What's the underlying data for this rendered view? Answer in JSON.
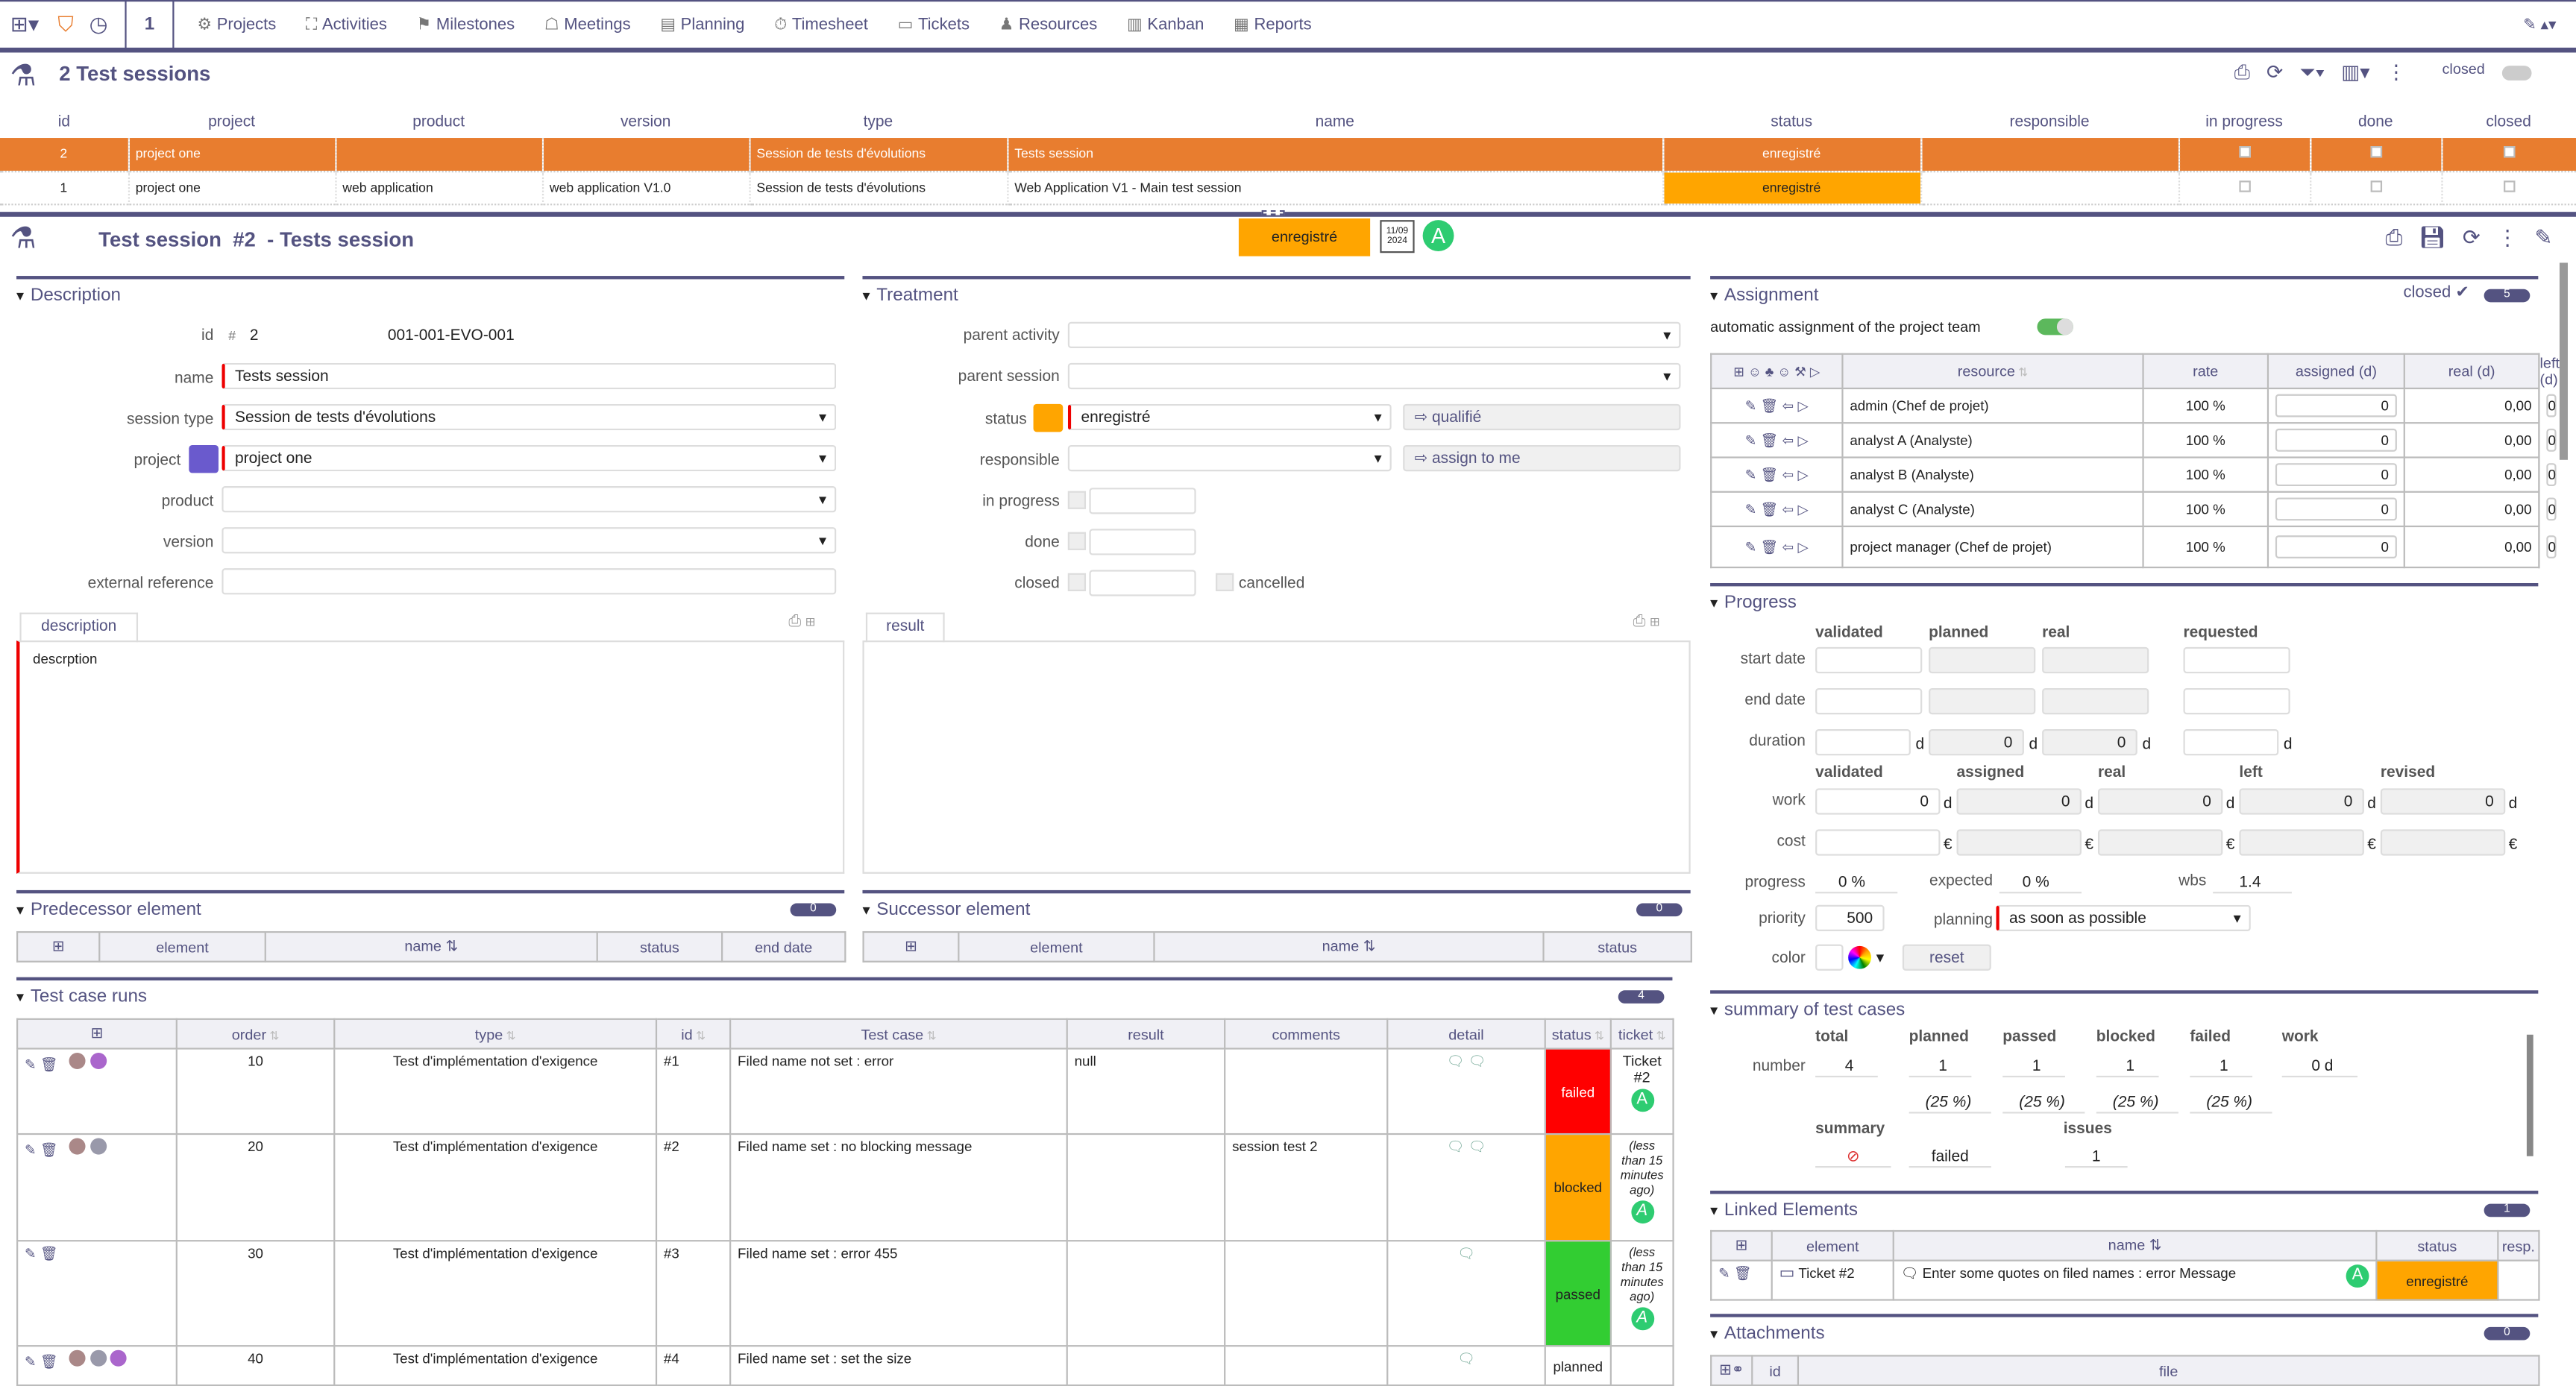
{
  "topbar": {
    "counter": "1",
    "menu": [
      {
        "label": "Projects",
        "icon": "gear-icon",
        "glyph": "⚙"
      },
      {
        "label": "Activities",
        "icon": "activities-icon",
        "glyph": "⛶"
      },
      {
        "label": "Milestones",
        "icon": "flag-icon",
        "glyph": "⚑"
      },
      {
        "label": "Meetings",
        "icon": "meeting-icon",
        "glyph": "☖"
      },
      {
        "label": "Planning",
        "icon": "planning-icon",
        "glyph": "▤"
      },
      {
        "label": "Timesheet",
        "icon": "stopwatch-icon",
        "glyph": "⏱"
      },
      {
        "label": "Tickets",
        "icon": "ticket-icon",
        "glyph": "▭"
      },
      {
        "label": "Resources",
        "icon": "person-icon",
        "glyph": "♟"
      },
      {
        "label": "Kanban",
        "icon": "kanban-icon",
        "glyph": "▥"
      },
      {
        "label": "Reports",
        "icon": "chart-icon",
        "glyph": "▦"
      }
    ]
  },
  "list": {
    "title": "2 Test sessions",
    "closed_label": "closed",
    "columns": [
      "id",
      "project",
      "product",
      "version",
      "type",
      "name",
      "status",
      "responsible",
      "in progress",
      "done",
      "closed"
    ],
    "rows": [
      {
        "id": "2",
        "project": "project one",
        "product": "",
        "version": "",
        "type": "Session de tests d'évolutions",
        "name": "Tests session",
        "status": "enregistré",
        "responsible": "",
        "selected": true
      },
      {
        "id": "1",
        "project": "project one",
        "product": "web application",
        "version": "web application V1.0",
        "type": "Session de tests d'évolutions",
        "name": "Web Application V1 - Main test session",
        "status": "enregistré",
        "responsible": "",
        "selected": false
      }
    ]
  },
  "detail": {
    "title": "Test session  #2  - Tests session",
    "status": "enregistré",
    "date_icon_text": "11/09\n2024",
    "avatar": "A",
    "description": {
      "title": "Description",
      "id_label": "id",
      "id_hash": "#",
      "id": "2",
      "ref": "001-001-EVO-001",
      "name_label": "name",
      "name": "Tests session",
      "session_type_label": "session type",
      "session_type": "Session de tests d'évolutions",
      "project_label": "project",
      "project": "project one",
      "project_color": "#6A5ACD",
      "product_label": "product",
      "product": "",
      "version_label": "version",
      "version": "",
      "external_reference_label": "external reference",
      "external_reference": "",
      "tab": "description",
      "text": "descrption"
    },
    "treatment": {
      "title": "Treatment",
      "parent_activity_label": "parent activity",
      "parent_session_label": "parent session",
      "status_label": "status",
      "status": "enregistré",
      "status_color": "#FFA500",
      "qualify_button": "qualifié",
      "responsible_label": "responsible",
      "assign_button": "assign to me",
      "in_progress_label": "in progress",
      "done_label": "done",
      "closed_label": "closed",
      "cancelled_label": "cancelled",
      "tab": "result"
    },
    "predecessor": {
      "title": "Predecessor element",
      "count": "0",
      "columns": [
        "element",
        "name",
        "status",
        "end date"
      ]
    },
    "successor": {
      "title": "Successor element",
      "count": "0",
      "columns": [
        "element",
        "name",
        "status"
      ]
    },
    "test_case_runs": {
      "title": "Test case runs",
      "count": "4",
      "columns": [
        "order",
        "type",
        "id",
        "Test case",
        "result",
        "comments",
        "detail",
        "status",
        "ticket"
      ],
      "rows": [
        {
          "order": "10",
          "type": "Test d'implémentation d'exigence",
          "id": "#1",
          "test_case": "Filed name not set : error",
          "result": "null",
          "comments": "",
          "status": "failed",
          "status_color": "#FF0000",
          "ticket": "Ticket #2"
        },
        {
          "order": "20",
          "type": "Test d'implémentation d'exigence",
          "id": "#2",
          "test_case": "Filed name set : no blocking message",
          "result": "",
          "comments": "session test 2",
          "status": "blocked",
          "status_color": "#FFA500",
          "ticket": "(less than 15 minutes ago)"
        },
        {
          "order": "30",
          "type": "Test d'implémentation d'exigence",
          "id": "#3",
          "test_case": "Filed name set : error 455",
          "result": "",
          "comments": "",
          "status": "passed",
          "status_color": "#32CD32",
          "ticket": "(less than 15 minutes ago)"
        },
        {
          "order": "40",
          "type": "Test d'implémentation d'exigence",
          "id": "#4",
          "test_case": "Filed name set : set the size",
          "result": "",
          "comments": "",
          "status": "planned",
          "status_color": "",
          "ticket": ""
        }
      ]
    },
    "assignment": {
      "title": "Assignment",
      "closed_label": "closed",
      "count": "5",
      "auto_label": "automatic assignment of the project team",
      "auto_on": true,
      "columns": [
        "resource",
        "rate",
        "assigned (d)",
        "real (d)",
        "left (d)"
      ],
      "rows": [
        {
          "resource": "admin (Chef de projet)",
          "rate": "100 %",
          "assigned": "0",
          "real": "0,00",
          "left": "0"
        },
        {
          "resource": "analyst A (Analyste)",
          "rate": "100 %",
          "assigned": "0",
          "real": "0,00",
          "left": "0"
        },
        {
          "resource": "analyst B (Analyste)",
          "rate": "100 %",
          "assigned": "0",
          "real": "0,00",
          "left": "0"
        },
        {
          "resource": "analyst C (Analyste)",
          "rate": "100 %",
          "assigned": "0",
          "real": "0,00",
          "left": "0"
        },
        {
          "resource": "project manager (Chef de projet)",
          "rate": "100 %",
          "assigned": "0",
          "real": "0,00",
          "left": "0"
        }
      ]
    },
    "progress": {
      "title": "Progress",
      "date_cols": [
        "validated",
        "planned",
        "real",
        "requested"
      ],
      "start_label": "start date",
      "end_label": "end date",
      "duration_label": "duration",
      "duration": [
        "",
        "0",
        "0",
        ""
      ],
      "unit_d": "d",
      "unit_eur": "€",
      "work_cols": [
        "validated",
        "assigned",
        "real",
        "left",
        "revised"
      ],
      "work_label": "work",
      "work": [
        "0",
        "0",
        "0",
        "0",
        "0"
      ],
      "cost_label": "cost",
      "progress_label": "progress",
      "progress": "0 %",
      "expected_label": "expected",
      "expected": "0 %",
      "wbs_label": "wbs",
      "wbs": "1.4",
      "priority_label": "priority",
      "priority": "500",
      "planning_label": "planning",
      "planning": "as soon as possible",
      "color_label": "color",
      "reset": "reset"
    },
    "summary": {
      "title": "summary of test cases",
      "cols": [
        "total",
        "planned",
        "passed",
        "blocked",
        "failed",
        "work"
      ],
      "number_label": "number",
      "values": [
        "4",
        "1",
        "1",
        "1",
        "1",
        "0 d"
      ],
      "pcts": [
        "(25 %)",
        "(25 %)",
        "(25 %)",
        "(25 %)"
      ],
      "summary_label": "summary",
      "summary": "failed",
      "issues_label": "issues",
      "issues": "1"
    },
    "linked": {
      "title": "Linked Elements",
      "count": "1",
      "columns": [
        "element",
        "name",
        "status",
        "resp."
      ],
      "row": {
        "element": "Ticket #2",
        "name": "Enter some quotes on filed names : error Message",
        "status": "enregistré"
      }
    },
    "attachments": {
      "title": "Attachments",
      "count": "0",
      "columns": [
        "id",
        "file"
      ]
    }
  }
}
